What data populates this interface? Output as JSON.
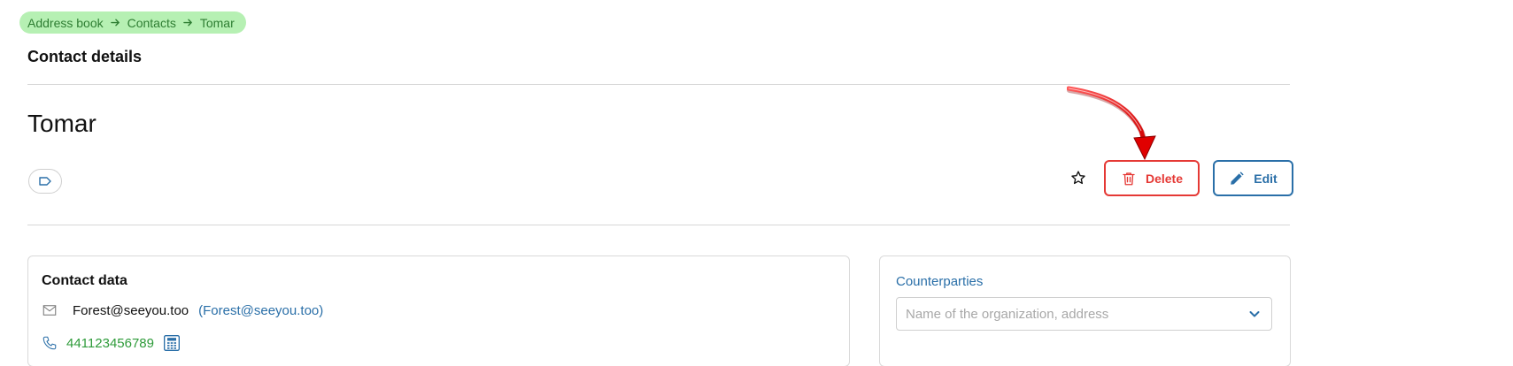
{
  "breadcrumb": {
    "items": [
      "Address book",
      "Contacts",
      "Tomar"
    ],
    "bg_color": "#b6f0b3",
    "text_color": "#2e7d32"
  },
  "page": {
    "title": "Contact details"
  },
  "contact": {
    "name": "Tomar",
    "tag_icon": "tag-icon",
    "favorite_icon": "star-outline-icon"
  },
  "actions": {
    "delete_label": "Delete",
    "delete_icon": "trash-icon",
    "delete_color": "#e53935",
    "edit_label": "Edit",
    "edit_icon": "pencil-icon",
    "edit_color": "#2a6fa8"
  },
  "annotation": {
    "arrow_color": "#e00000",
    "arrow_target": "delete-button"
  },
  "contact_data": {
    "title": "Contact data",
    "email": {
      "icon": "envelope-icon",
      "address": "Forest@seeyou.too",
      "alias": "(Forest@seeyou.too)"
    },
    "phone": {
      "icon": "phone-icon",
      "number": "441123456789",
      "book_icon": "phone-book-icon"
    }
  },
  "counterparties": {
    "label": "Counterparties",
    "placeholder": "Name of the organization, address",
    "icon": "chevron-down-icon"
  }
}
